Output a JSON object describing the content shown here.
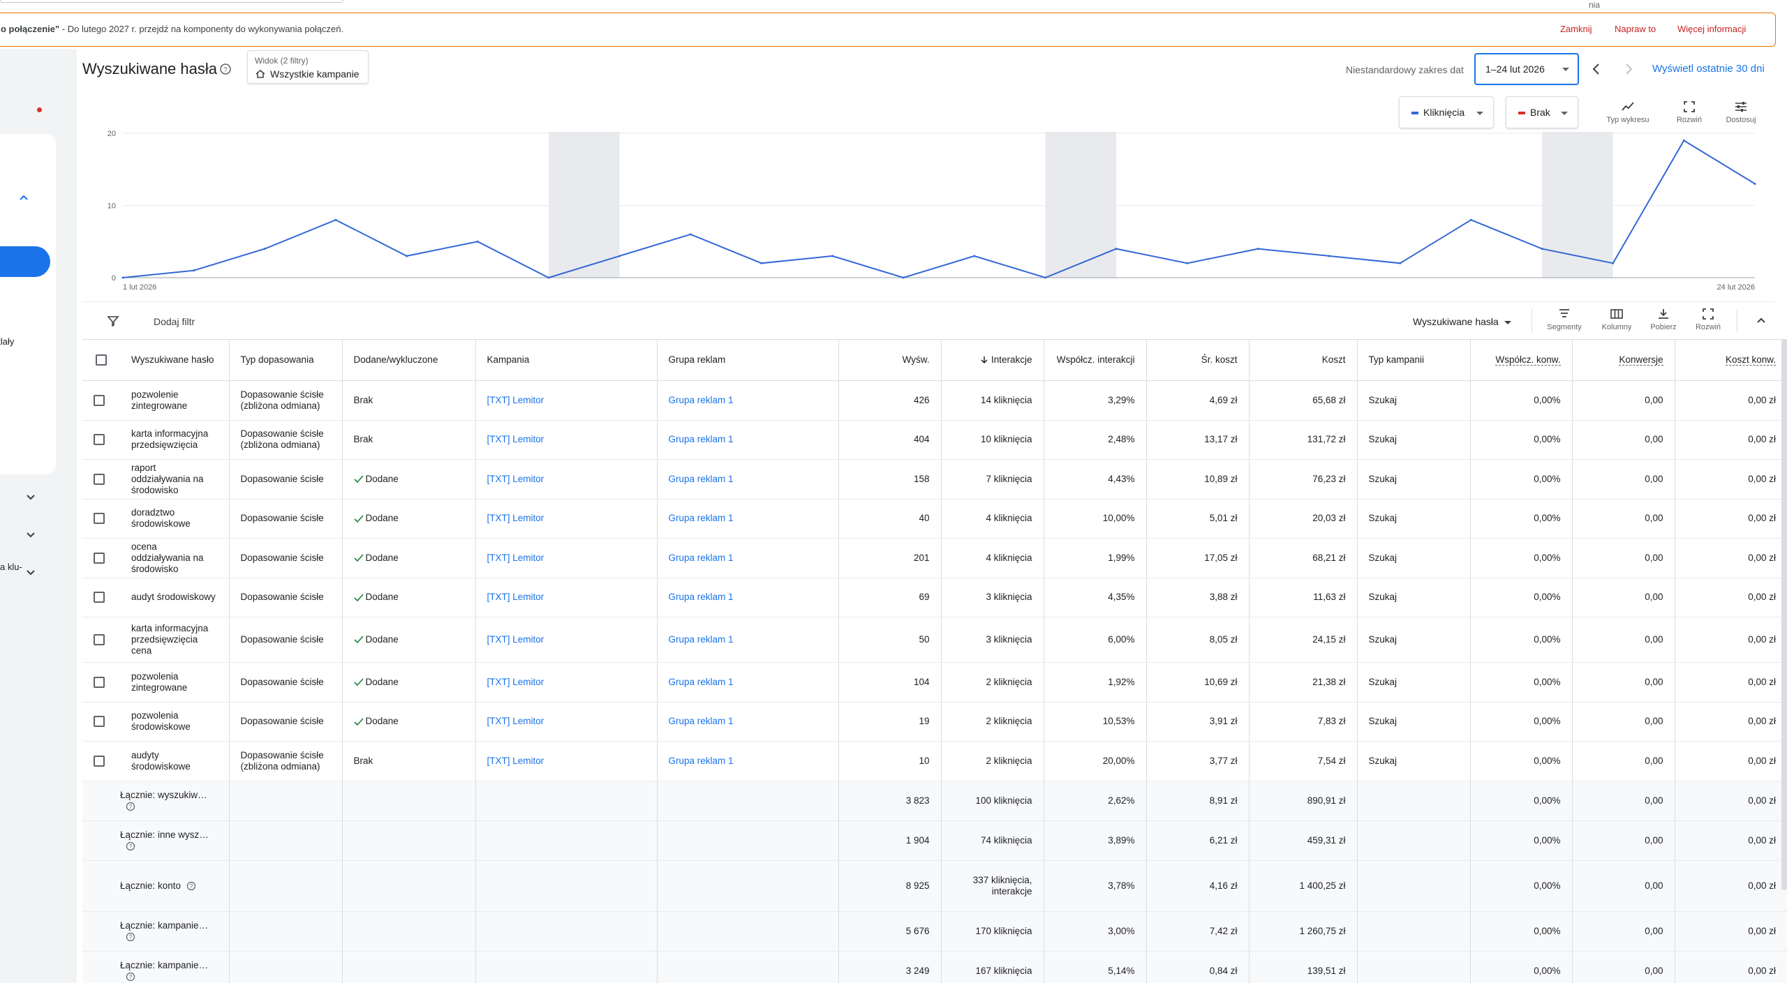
{
  "top": {
    "tail_text": "nia"
  },
  "notice": {
    "bold": "o połączenie\"",
    "rest": " - Do lutego 2027 r. przejdź na komponenty do wykonywania połączeń.",
    "actions": [
      "Zamknij",
      "Napraw to",
      "Więcej informacji"
    ]
  },
  "leftnav": {
    "label1": "etlały",
    "label2": "a klu-"
  },
  "header": {
    "title": "Wyszukiwane hasła",
    "view_label": "Widok (2 filtry)",
    "view_value": "Wszystkie kampanie",
    "date_label": "Niestandardowy zakres dat",
    "date_value": "1–24 lut 2026",
    "show_last": "Wyświetl ostatnie 30 dni"
  },
  "chart_controls": {
    "metric1": "Kliknięcia",
    "metric2": "Brak",
    "tools": [
      "Typ wykresu",
      "Rozwiń",
      "Dostosuj"
    ]
  },
  "chart_data": {
    "type": "line",
    "x_start_label": "1 lut 2026",
    "x_end_label": "24 lut 2026",
    "y_ticks": [
      "20",
      "10",
      "0"
    ],
    "ylim": [
      0,
      20
    ],
    "x": [
      "1 lut",
      "2 lut",
      "3 lut",
      "4 lut",
      "5 lut",
      "6 lut",
      "7 lut",
      "8 lut",
      "9 lut",
      "10 lut",
      "11 lut",
      "12 lut",
      "13 lut",
      "14 lut",
      "15 lut",
      "16 lut",
      "17 lut",
      "18 lut",
      "19 lut",
      "20 lut",
      "21 lut",
      "22 lut",
      "23 lut",
      "24 lut"
    ],
    "series": [
      {
        "values": [
          0,
          1,
          4,
          8,
          3,
          5,
          0,
          3,
          6,
          2,
          3,
          0,
          3,
          0,
          4,
          2,
          4,
          3,
          2,
          8,
          4,
          2,
          19,
          13
        ],
        "color": "#3367d6"
      }
    ],
    "weekend_bands": [
      [
        6,
        7
      ],
      [
        13,
        14
      ],
      [
        20,
        21
      ]
    ],
    "grid": true
  },
  "filterbar": {
    "add_filter": "Dodaj filtr",
    "select": "Wyszukiwane hasła",
    "tools": [
      "Segmenty",
      "Kolumny",
      "Pobierz",
      "Rozwiń"
    ]
  },
  "table": {
    "headers": [
      "Wyszukiwane hasło",
      "Typ dopasowania",
      "Dodane/wykluczone",
      "Kampania",
      "Grupa reklam",
      "Wyśw.",
      "Interakcje",
      "Współcz. interakcji",
      "Śr. koszt",
      "Koszt",
      "Typ kampanii",
      "Współcz. konw.",
      "Konwersje",
      "Koszt konw."
    ],
    "rows": [
      [
        "pozwolenie zintegrowane",
        "Dopasowanie ścisłe (zbliżona odmiana)",
        "Brak",
        "[TXT] Lemitor",
        "Grupa reklam 1",
        "426",
        "14 kliknięcia",
        "3,29%",
        "4,69 zł",
        "65,68 zł",
        "Szukaj",
        "0,00%",
        "0,00",
        "0,00 zł"
      ],
      [
        "karta informacyjna przedsięwzięcia",
        "Dopasowanie ścisłe (zbliżona odmiana)",
        "Brak",
        "[TXT] Lemitor",
        "Grupa reklam 1",
        "404",
        "10 kliknięcia",
        "2,48%",
        "13,17 zł",
        "131,72 zł",
        "Szukaj",
        "0,00%",
        "0,00",
        "0,00 zł"
      ],
      [
        "raport oddziaływania na środowisko",
        "Dopasowanie ścisłe",
        "Dodane",
        "[TXT] Lemitor",
        "Grupa reklam 1",
        "158",
        "7 kliknięcia",
        "4,43%",
        "10,89 zł",
        "76,23 zł",
        "Szukaj",
        "0,00%",
        "0,00",
        "0,00 zł"
      ],
      [
        "doradztwo środowiskowe",
        "Dopasowanie ścisłe",
        "Dodane",
        "[TXT] Lemitor",
        "Grupa reklam 1",
        "40",
        "4 kliknięcia",
        "10,00%",
        "5,01 zł",
        "20,03 zł",
        "Szukaj",
        "0,00%",
        "0,00",
        "0,00 zł"
      ],
      [
        "ocena oddziaływania na środowisko",
        "Dopasowanie ścisłe",
        "Dodane",
        "[TXT] Lemitor",
        "Grupa reklam 1",
        "201",
        "4 kliknięcia",
        "1,99%",
        "17,05 zł",
        "68,21 zł",
        "Szukaj",
        "0,00%",
        "0,00",
        "0,00 zł"
      ],
      [
        "audyt środowiskowy",
        "Dopasowanie ścisłe",
        "Dodane",
        "[TXT] Lemitor",
        "Grupa reklam 1",
        "69",
        "3 kliknięcia",
        "4,35%",
        "3,88 zł",
        "11,63 zł",
        "Szukaj",
        "0,00%",
        "0,00",
        "0,00 zł"
      ],
      [
        "karta informacyjna przedsięwzięcia cena",
        "Dopasowanie ścisłe",
        "Dodane",
        "[TXT] Lemitor",
        "Grupa reklam 1",
        "50",
        "3 kliknięcia",
        "6,00%",
        "8,05 zł",
        "24,15 zł",
        "Szukaj",
        "0,00%",
        "0,00",
        "0,00 zł"
      ],
      [
        "pozwolenia zintegrowane",
        "Dopasowanie ścisłe",
        "Dodane",
        "[TXT] Lemitor",
        "Grupa reklam 1",
        "104",
        "2 kliknięcia",
        "1,92%",
        "10,69 zł",
        "21,38 zł",
        "Szukaj",
        "0,00%",
        "0,00",
        "0,00 zł"
      ],
      [
        "pozwolenia środowiskowe",
        "Dopasowanie ścisłe",
        "Dodane",
        "[TXT] Lemitor",
        "Grupa reklam 1",
        "19",
        "2 kliknięcia",
        "10,53%",
        "3,91 zł",
        "7,83 zł",
        "Szukaj",
        "0,00%",
        "0,00",
        "0,00 zł"
      ],
      [
        "audyty środowiskowe",
        "Dopasowanie ścisłe (zbliżona odmiana)",
        "Brak",
        "[TXT] Lemitor",
        "Grupa reklam 1",
        "10",
        "2 kliknięcia",
        "20,00%",
        "3,77 zł",
        "7,54 zł",
        "Szukaj",
        "0,00%",
        "0,00",
        "0,00 zł"
      ]
    ],
    "totals": [
      [
        "Łącznie: wyszukiw…",
        "3 823",
        "100 kliknięcia",
        "2,62%",
        "8,91 zł",
        "890,91 zł",
        "0,00%",
        "0,00",
        "0,00 zł"
      ],
      [
        "Łącznie: inne wysz…",
        "1 904",
        "74 kliknięcia",
        "3,89%",
        "6,21 zł",
        "459,31 zł",
        "0,00%",
        "0,00",
        "0,00 zł"
      ],
      [
        "Łącznie: konto",
        "8 925",
        "337 kliknięcia, interakcje",
        "3,78%",
        "4,16 zł",
        "1 400,25 zł",
        "0,00%",
        "0,00",
        "0,00 zł"
      ],
      [
        "Łącznie: kampanie…",
        "5 676",
        "170 kliknięcia",
        "3,00%",
        "7,42 zł",
        "1 260,75 zł",
        "0,00%",
        "0,00",
        "0,00 zł"
      ],
      [
        "Łącznie: kampanie…",
        "3 249",
        "167 kliknięcia",
        "5,14%",
        "0,84 zł",
        "139,51 zł",
        "0,00%",
        "0,00",
        "0,00 zł"
      ]
    ]
  }
}
